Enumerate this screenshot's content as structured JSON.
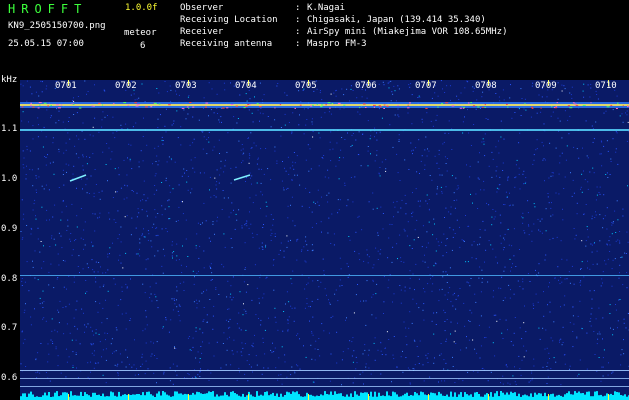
{
  "app": {
    "name": "HROFFT",
    "version": "1.0.0f",
    "filename": "KN9_2505150700.png",
    "datetime": "25.05.15 07:00",
    "meteor_label": "meteor",
    "meteor_count": "6"
  },
  "info": [
    {
      "key": "Observer",
      "sep": ":",
      "value": "K.Nagai"
    },
    {
      "key": "Receiving Location",
      "sep": ":",
      "value": "Chigasaki, Japan (139.414 35.340)"
    },
    {
      "key": "Receiver",
      "sep": ":",
      "value": "AirSpy mini (Miakejima VOR 108.65MHz)"
    },
    {
      "key": "Receiving antenna",
      "sep": ":",
      "value": "Maspro FM-3"
    }
  ],
  "axis": {
    "y_unit": "kHz",
    "y_labels": [
      "1.1",
      "1.0",
      "0.9",
      "0.8",
      "0.7",
      "0.6"
    ],
    "time_labels": [
      "0701",
      "0702",
      "0703",
      "0704",
      "0705",
      "0706",
      "0707",
      "0708",
      "0709",
      "0710"
    ]
  },
  "colors": {
    "background": "#000000",
    "spectrum_bg": "#0a1a66",
    "title_green": "#3cff3c",
    "version_yellow": "#ffff33",
    "noise_cyan": "#00e5ff"
  }
}
